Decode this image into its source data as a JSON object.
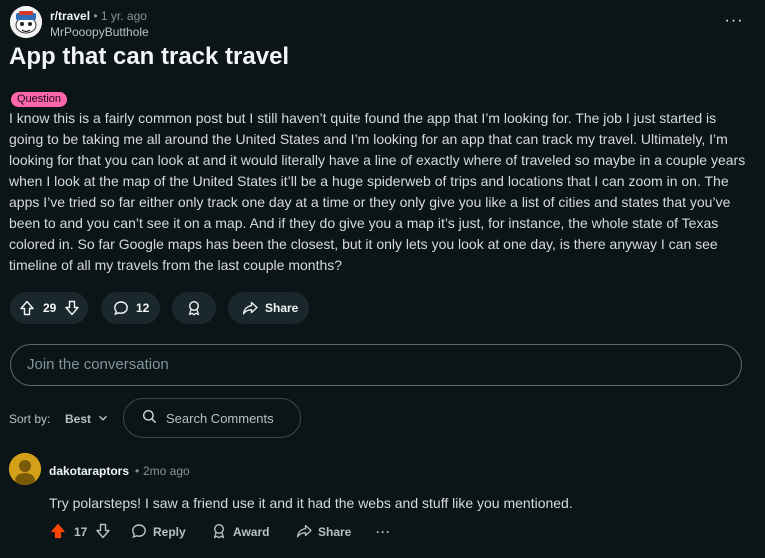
{
  "post": {
    "subreddit": "r/travel",
    "separator": "•",
    "age": "1 yr. ago",
    "author": "MrPooopyButthole",
    "title": "App that can track travel",
    "flair": "Question",
    "flair_color": "#ff66ac",
    "body": "I know this is a fairly common post but I still haven’t quite found the app that I’m looking for. The job I just started is going to be taking me all around the United States and I’m looking for an app that can track my travel. Ultimately, I’m looking for that you can look at and it would literally have a line of exactly where of traveled so maybe in a couple years when I look at the map of the United States it’ll be a huge spiderweb of trips and locations that I can zoom in on. The apps I’ve tried so far either only track one day at a time or they only give you like a list of cities and states that you’ve been to and you can’t see it on a map. And if they do give you a map it’s just, for instance, the whole state of Texas colored in. So far Google maps has been the closest, but it only lets you look at one day, is there anyway I can see timeline of all my travels from the last couple months?"
  },
  "actions": {
    "votes": "29",
    "comments": "12",
    "share": "Share",
    "icons": [
      "upvote-icon",
      "downvote-icon",
      "comment-icon",
      "award-icon",
      "share-icon",
      "more-icon"
    ]
  },
  "composer": {
    "placeholder": "Join the conversation"
  },
  "sort": {
    "label": "Sort by:",
    "value": "Best",
    "search_placeholder": "Search Comments"
  },
  "comment": {
    "author": "dakotaraptors",
    "separator": "•",
    "age": "2mo ago",
    "text": "Try polarsteps! I saw a friend use it and it had the webs and stuff like you mentioned.",
    "votes": "17",
    "reply": "Reply",
    "award": "Award",
    "share": "Share",
    "more": "···",
    "upvote_color": "#ff4500"
  },
  "colors": {
    "background": "#0b1416",
    "pill": "#1a282d",
    "accent_upvote": "#ff4500"
  }
}
